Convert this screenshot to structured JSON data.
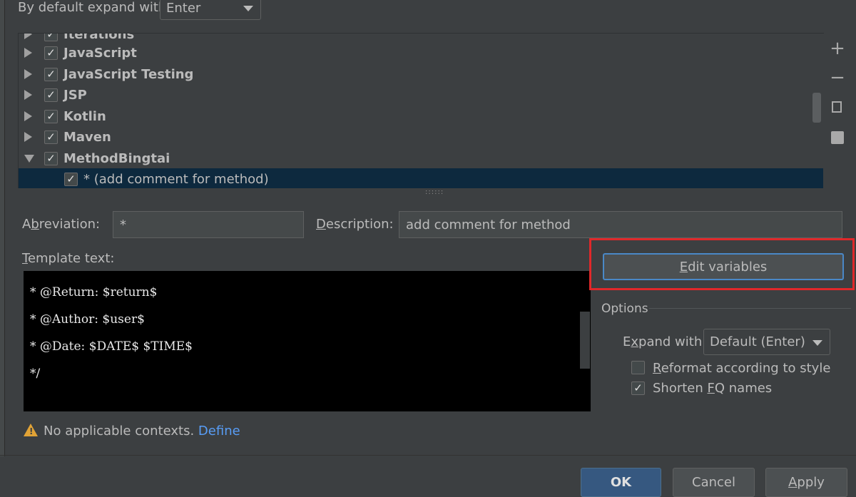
{
  "top": {
    "expand_label": "By default expand with",
    "expand_value": "Enter"
  },
  "tree": {
    "partial_label": "Iterations",
    "groups": [
      {
        "label": "JavaScript",
        "checked": true,
        "expanded": false
      },
      {
        "label": "JavaScript Testing",
        "checked": true,
        "expanded": false
      },
      {
        "label": "JSP",
        "checked": true,
        "expanded": false
      },
      {
        "label": "Kotlin",
        "checked": true,
        "expanded": false
      },
      {
        "label": "Maven",
        "checked": true,
        "expanded": false
      },
      {
        "label": "MethodBingtai",
        "checked": true,
        "expanded": true
      }
    ],
    "selected_child": "* (add comment for method)",
    "check_glyph": "✓"
  },
  "side_toolbar": {
    "add_icon": "plus-icon",
    "remove_icon": "minus-icon",
    "copy_icon": "copy-icon",
    "group_icon": "template-group-icon"
  },
  "abbreviation": {
    "label_pre": "Ab",
    "label_mnemonic": "b",
    "label_post": "reviation:",
    "value": "*"
  },
  "description": {
    "label_mnemonic": "D",
    "label_post": "escription:",
    "value": "add comment for method"
  },
  "template": {
    "label_mnemonic": "T",
    "label_post": "emplate text:",
    "lines": [
      "* @Return: $return$",
      "* @Author: $user$",
      "* @Date: $DATE$ $TIME$",
      "*/"
    ]
  },
  "edit_variables": {
    "mnemonic": "E",
    "rest": "dit variables"
  },
  "options": {
    "title": "Options",
    "expand_pre": "E",
    "expand_mnemonic": "x",
    "expand_post": "pand with",
    "expand_value": "Default (Enter)",
    "reformat_mnemonic": "R",
    "reformat_post": "eformat according to style",
    "reformat_checked": false,
    "shorten_pre": "Shorten ",
    "shorten_mnemonic": "F",
    "shorten_post": "Q names",
    "shorten_checked": true
  },
  "context": {
    "warning_icon": "warning-icon",
    "message": "No applicable contexts.",
    "link": "Define"
  },
  "footer": {
    "ok": "OK",
    "cancel": "Cancel",
    "apply_mnemonic": "A",
    "apply_post": "pply"
  },
  "colors": {
    "background": "#3c3f41",
    "selection": "#0d293e",
    "editor_bg": "#000000",
    "highlight_box": "#e0282a",
    "link": "#589df6",
    "ok_button": "#365880"
  }
}
